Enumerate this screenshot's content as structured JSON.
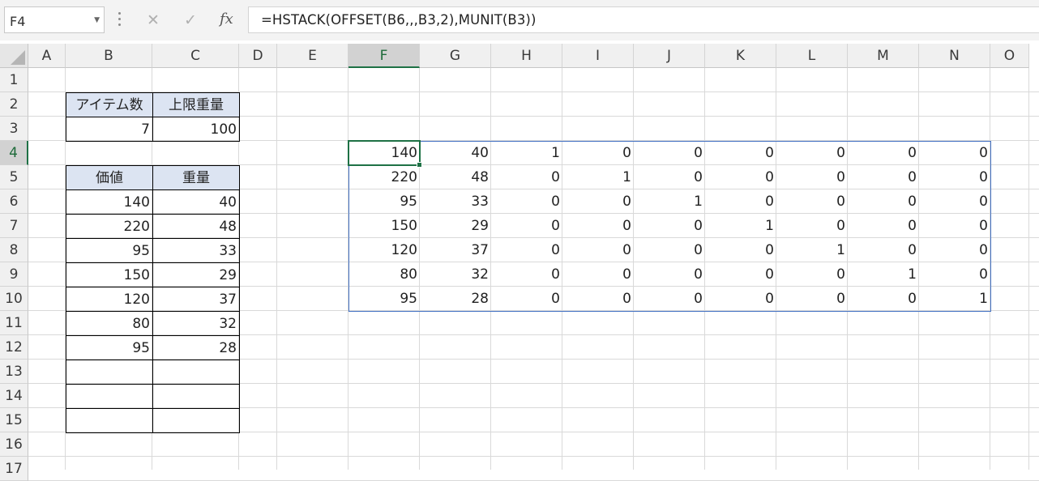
{
  "name_box": {
    "value": "F4"
  },
  "formula_bar": {
    "cancel_glyph": "✕",
    "enter_glyph": "✓",
    "fx_label": "fx",
    "formula": "=HSTACK(OFFSET(B6,,,B3,2),MUNIT(B3))"
  },
  "columns": [
    "A",
    "B",
    "C",
    "D",
    "E",
    "F",
    "G",
    "H",
    "I",
    "J",
    "K",
    "L",
    "M",
    "N",
    "O"
  ],
  "rows": [
    "1",
    "2",
    "3",
    "4",
    "5",
    "6",
    "7",
    "8",
    "9",
    "10",
    "11",
    "12",
    "13",
    "14",
    "15",
    "16",
    "17"
  ],
  "selected_cell": {
    "column": "F",
    "row": "4"
  },
  "items_table": {
    "header": [
      "アイテム数",
      "上限重量"
    ],
    "values": [
      "7",
      "100"
    ]
  },
  "value_weight_table": {
    "header": [
      "価値",
      "重量"
    ],
    "rows": [
      [
        "140",
        "40"
      ],
      [
        "220",
        "48"
      ],
      [
        "95",
        "33"
      ],
      [
        "150",
        "29"
      ],
      [
        "120",
        "37"
      ],
      [
        "80",
        "32"
      ],
      [
        "95",
        "28"
      ],
      [
        "",
        ""
      ],
      [
        "",
        ""
      ],
      [
        "",
        ""
      ]
    ]
  },
  "spill_result": {
    "rows": [
      [
        "140",
        "40",
        "1",
        "0",
        "0",
        "0",
        "0",
        "0",
        "0"
      ],
      [
        "220",
        "48",
        "0",
        "1",
        "0",
        "0",
        "0",
        "0",
        "0"
      ],
      [
        "95",
        "33",
        "0",
        "0",
        "1",
        "0",
        "0",
        "0",
        "0"
      ],
      [
        "150",
        "29",
        "0",
        "0",
        "0",
        "1",
        "0",
        "0",
        "0"
      ],
      [
        "120",
        "37",
        "0",
        "0",
        "0",
        "0",
        "1",
        "0",
        "0"
      ],
      [
        "80",
        "32",
        "0",
        "0",
        "0",
        "0",
        "0",
        "1",
        "0"
      ],
      [
        "95",
        "28",
        "0",
        "0",
        "0",
        "0",
        "0",
        "0",
        "1"
      ]
    ]
  },
  "colors": {
    "header_fill": "#dce4f2",
    "selection": "#1e7145",
    "spill_border": "#4472c4"
  }
}
